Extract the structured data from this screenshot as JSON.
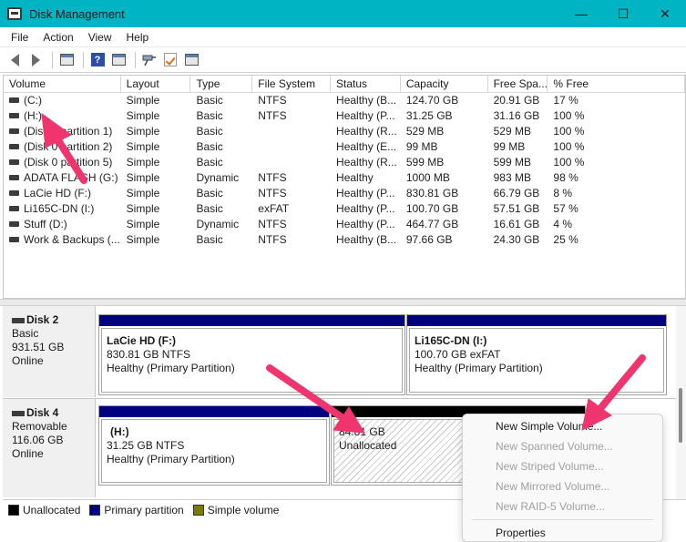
{
  "window": {
    "title": "Disk Management",
    "controls": {
      "minimize": "—",
      "maximize": "☐",
      "close": "✕"
    }
  },
  "menu": [
    "File",
    "Action",
    "View",
    "Help"
  ],
  "toolbar_icons": [
    "back-icon",
    "forward-icon",
    "disk-list-icon",
    "help-icon",
    "properties-icon",
    "connect-icon",
    "check-icon",
    "console-icon"
  ],
  "table": {
    "columns": [
      "Volume",
      "Layout",
      "Type",
      "File System",
      "Status",
      "Capacity",
      "Free Spa...",
      "% Free"
    ],
    "rows": [
      [
        "(C:)",
        "Simple",
        "Basic",
        "NTFS",
        "Healthy (B...",
        "124.70 GB",
        "20.91 GB",
        "17 %"
      ],
      [
        "(H:)",
        "Simple",
        "Basic",
        "NTFS",
        "Healthy (P...",
        "31.25 GB",
        "31.16 GB",
        "100 %"
      ],
      [
        "(Disk 0 partition 1)",
        "Simple",
        "Basic",
        "",
        "Healthy (R...",
        "529 MB",
        "529 MB",
        "100 %"
      ],
      [
        "(Disk 0 partition 2)",
        "Simple",
        "Basic",
        "",
        "Healthy (E...",
        "99 MB",
        "99 MB",
        "100 %"
      ],
      [
        "(Disk 0 partition 5)",
        "Simple",
        "Basic",
        "",
        "Healthy (R...",
        "599 MB",
        "599 MB",
        "100 %"
      ],
      [
        "ADATA FLASH (G:)",
        "Simple",
        "Dynamic",
        "NTFS",
        "Healthy",
        "1000 MB",
        "983 MB",
        "98 %"
      ],
      [
        "LaCie HD (F:)",
        "Simple",
        "Basic",
        "NTFS",
        "Healthy (P...",
        "830.81 GB",
        "66.79 GB",
        "8 %"
      ],
      [
        "Li165C-DN (I:)",
        "Simple",
        "Basic",
        "exFAT",
        "Healthy (P...",
        "100.70 GB",
        "57.51 GB",
        "57 %"
      ],
      [
        "Stuff (D:)",
        "Simple",
        "Dynamic",
        "NTFS",
        "Healthy (P...",
        "464.77 GB",
        "16.61 GB",
        "4 %"
      ],
      [
        "Work & Backups (...",
        "Simple",
        "Basic",
        "NTFS",
        "Healthy (B...",
        "97.66 GB",
        "24.30 GB",
        "25 %"
      ]
    ]
  },
  "disks": [
    {
      "name": "Disk 2",
      "type": "Basic",
      "size": "931.51 GB",
      "status": "Online",
      "partitions": [
        {
          "name": "LaCie HD  (F:)",
          "size": "830.81 GB NTFS",
          "status": "Healthy (Primary Partition)"
        },
        {
          "name": "Li165C-DN  (I:)",
          "size": "100.70 GB exFAT",
          "status": "Healthy (Primary Partition)"
        }
      ]
    },
    {
      "name": "Disk 4",
      "type": "Removable",
      "size": "116.06 GB",
      "status": "Online",
      "partitions": [
        {
          "name": "(H:)",
          "size": "31.25 GB NTFS",
          "status": "Healthy (Primary Partition)"
        },
        {
          "name": "",
          "size": "84.81 GB",
          "status": "Unallocated"
        }
      ]
    }
  ],
  "legend": [
    "Unallocated",
    "Primary partition",
    "Simple volume"
  ],
  "legend_colors": [
    "#000000",
    "#000080",
    "#7a7a00"
  ],
  "context_menu": [
    {
      "label": "New Simple Volume...",
      "enabled": true
    },
    {
      "label": "New Spanned Volume...",
      "enabled": false
    },
    {
      "label": "New Striped Volume...",
      "enabled": false
    },
    {
      "label": "New Mirrored Volume...",
      "enabled": false
    },
    {
      "label": "New RAID-5 Volume...",
      "enabled": false
    },
    {
      "label": "Properties",
      "enabled": true
    }
  ],
  "accent_colors": {
    "titlebar": "#00b4c3",
    "annotation_arrow": "#f0356e"
  }
}
